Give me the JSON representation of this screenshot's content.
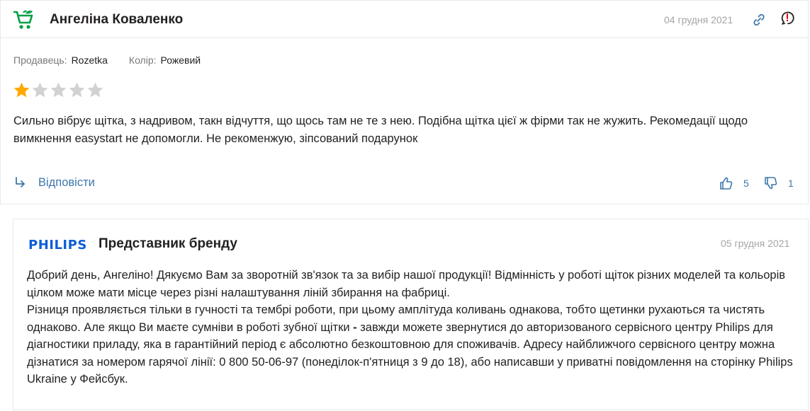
{
  "review": {
    "author": "Ангеліна Коваленко",
    "date": "04 грудня 2021",
    "seller_label": "Продавець:",
    "seller_value": "Rozetka",
    "color_label": "Колір:",
    "color_value": "Рожевий",
    "rating": 1,
    "rating_max": 5,
    "text": "Сильно вібрує щітка, з надривом, такн відчуття, що щось там не те з нею. Подібна щітка цієї ж фірми так не жужить. Рекомедації щодо вимкнення easystart не допомогли. Не рекоменжую, зіпсований подарунок",
    "reply_label": "Відповісти",
    "likes": "5",
    "dislikes": "1"
  },
  "brand_reply": {
    "logo_text": "PHILIPS",
    "author": "Представник бренду",
    "date": "05 грудня 2021",
    "paragraph1": "Добрий день, Ангеліно! Дякуємо Вам за зворотній зв'язок та за вибір нашої продукції! Відмінність у роботі щіток різних моделей та кольорів цілком може мати місце через різні налаштування ліній збирання на фабриці.",
    "paragraph2_before": "Різниця проявляється тільки в гучності та тембрі роботи, при цьому амплітуда коливань однакова, тобто щетинки рухаються та чистять однаково. Але якщо Ви маєте сумніви в роботі зубної щітки ",
    "paragraph2_dash": "-",
    "paragraph2_after": " завжди можете звернутися до авторизованого сервісного центру Philips для діагностики приладу, яка в гарантійний період є абсолютно безкоштовною для споживачів. Адресу найближчого сервісного центру можна дізнатися за номером гарячої лінії: 0 800 50-06-97 (понеділок-п'ятниця з 9 до 18), або написавши у приватні повідомлення на сторінку Philips Ukraine у Фейсбук."
  },
  "colors": {
    "accent_green": "#00a046",
    "link_blue": "#3e77aa",
    "star_filled": "#ffa900",
    "star_empty": "#d2d2d2",
    "philips_blue": "#0b5ed7"
  },
  "icons": {
    "avatar": "cart-icon",
    "link": "link-icon",
    "flag": "complaint-icon",
    "reply": "reply-arrow-icon",
    "like": "thumbs-up-icon",
    "dislike": "thumbs-down-icon"
  }
}
